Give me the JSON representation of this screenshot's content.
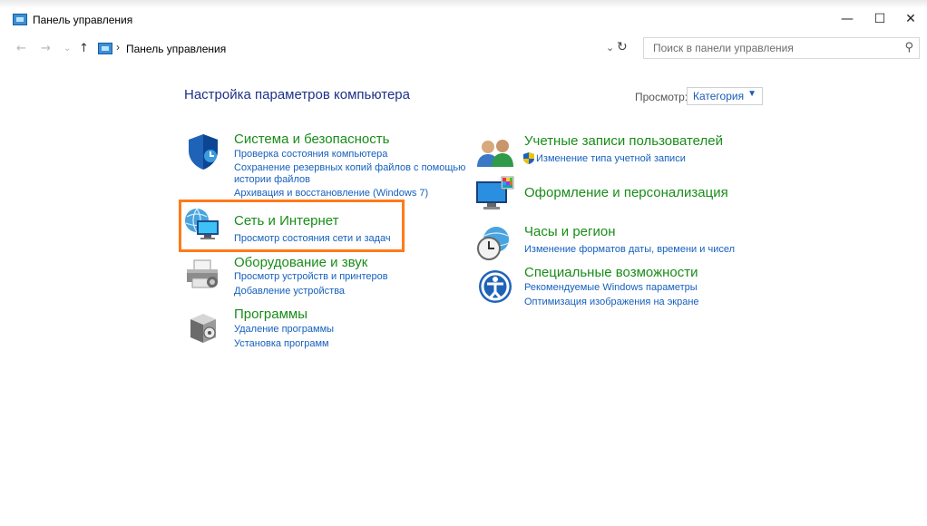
{
  "window": {
    "title": "Панель управления",
    "minimize": "—",
    "maximize": "☐",
    "close": "✕"
  },
  "nav": {
    "back": "←",
    "forward": "→",
    "recent": "⌄",
    "up": "↑",
    "separator": "›",
    "breadcrumb": "Панель управления",
    "dropdown": "⌄",
    "refresh": "↻"
  },
  "search": {
    "placeholder": "Поиск в панели управления",
    "icon": "⚲"
  },
  "main": {
    "heading": "Настройка параметров компьютера",
    "view_label": "Просмотр:",
    "view_value": "Категория",
    "view_arrow": "▼"
  },
  "categories_left": [
    {
      "title": "Система и безопасность",
      "links": [
        "Проверка состояния компьютера",
        "Сохранение резервных копий файлов с помощью",
        "истории файлов",
        "Архивация и восстановление (Windows 7)"
      ]
    },
    {
      "title": "Сеть и Интернет",
      "links": [
        "Просмотр состояния сети и задач"
      ]
    },
    {
      "title": "Оборудование и звук",
      "links": [
        "Просмотр устройств и принтеров",
        "Добавление устройства"
      ]
    },
    {
      "title": "Программы",
      "links": [
        "Удаление программы",
        "Установка программ"
      ]
    }
  ],
  "categories_right": [
    {
      "title": "Учетные записи пользователей",
      "links": [
        "Изменение типа учетной записи"
      ]
    },
    {
      "title": "Оформление и персонализация",
      "links": []
    },
    {
      "title": "Часы и регион",
      "links": [
        "Изменение форматов даты, времени и чисел"
      ]
    },
    {
      "title": "Специальные возможности",
      "links": [
        "Рекомендуемые Windows параметры",
        "Оптимизация изображения на экране"
      ]
    }
  ],
  "colors": {
    "category_title": "#198c19",
    "link": "#1560bd",
    "heading": "#1e3287",
    "highlight": "#ff7a1a"
  }
}
